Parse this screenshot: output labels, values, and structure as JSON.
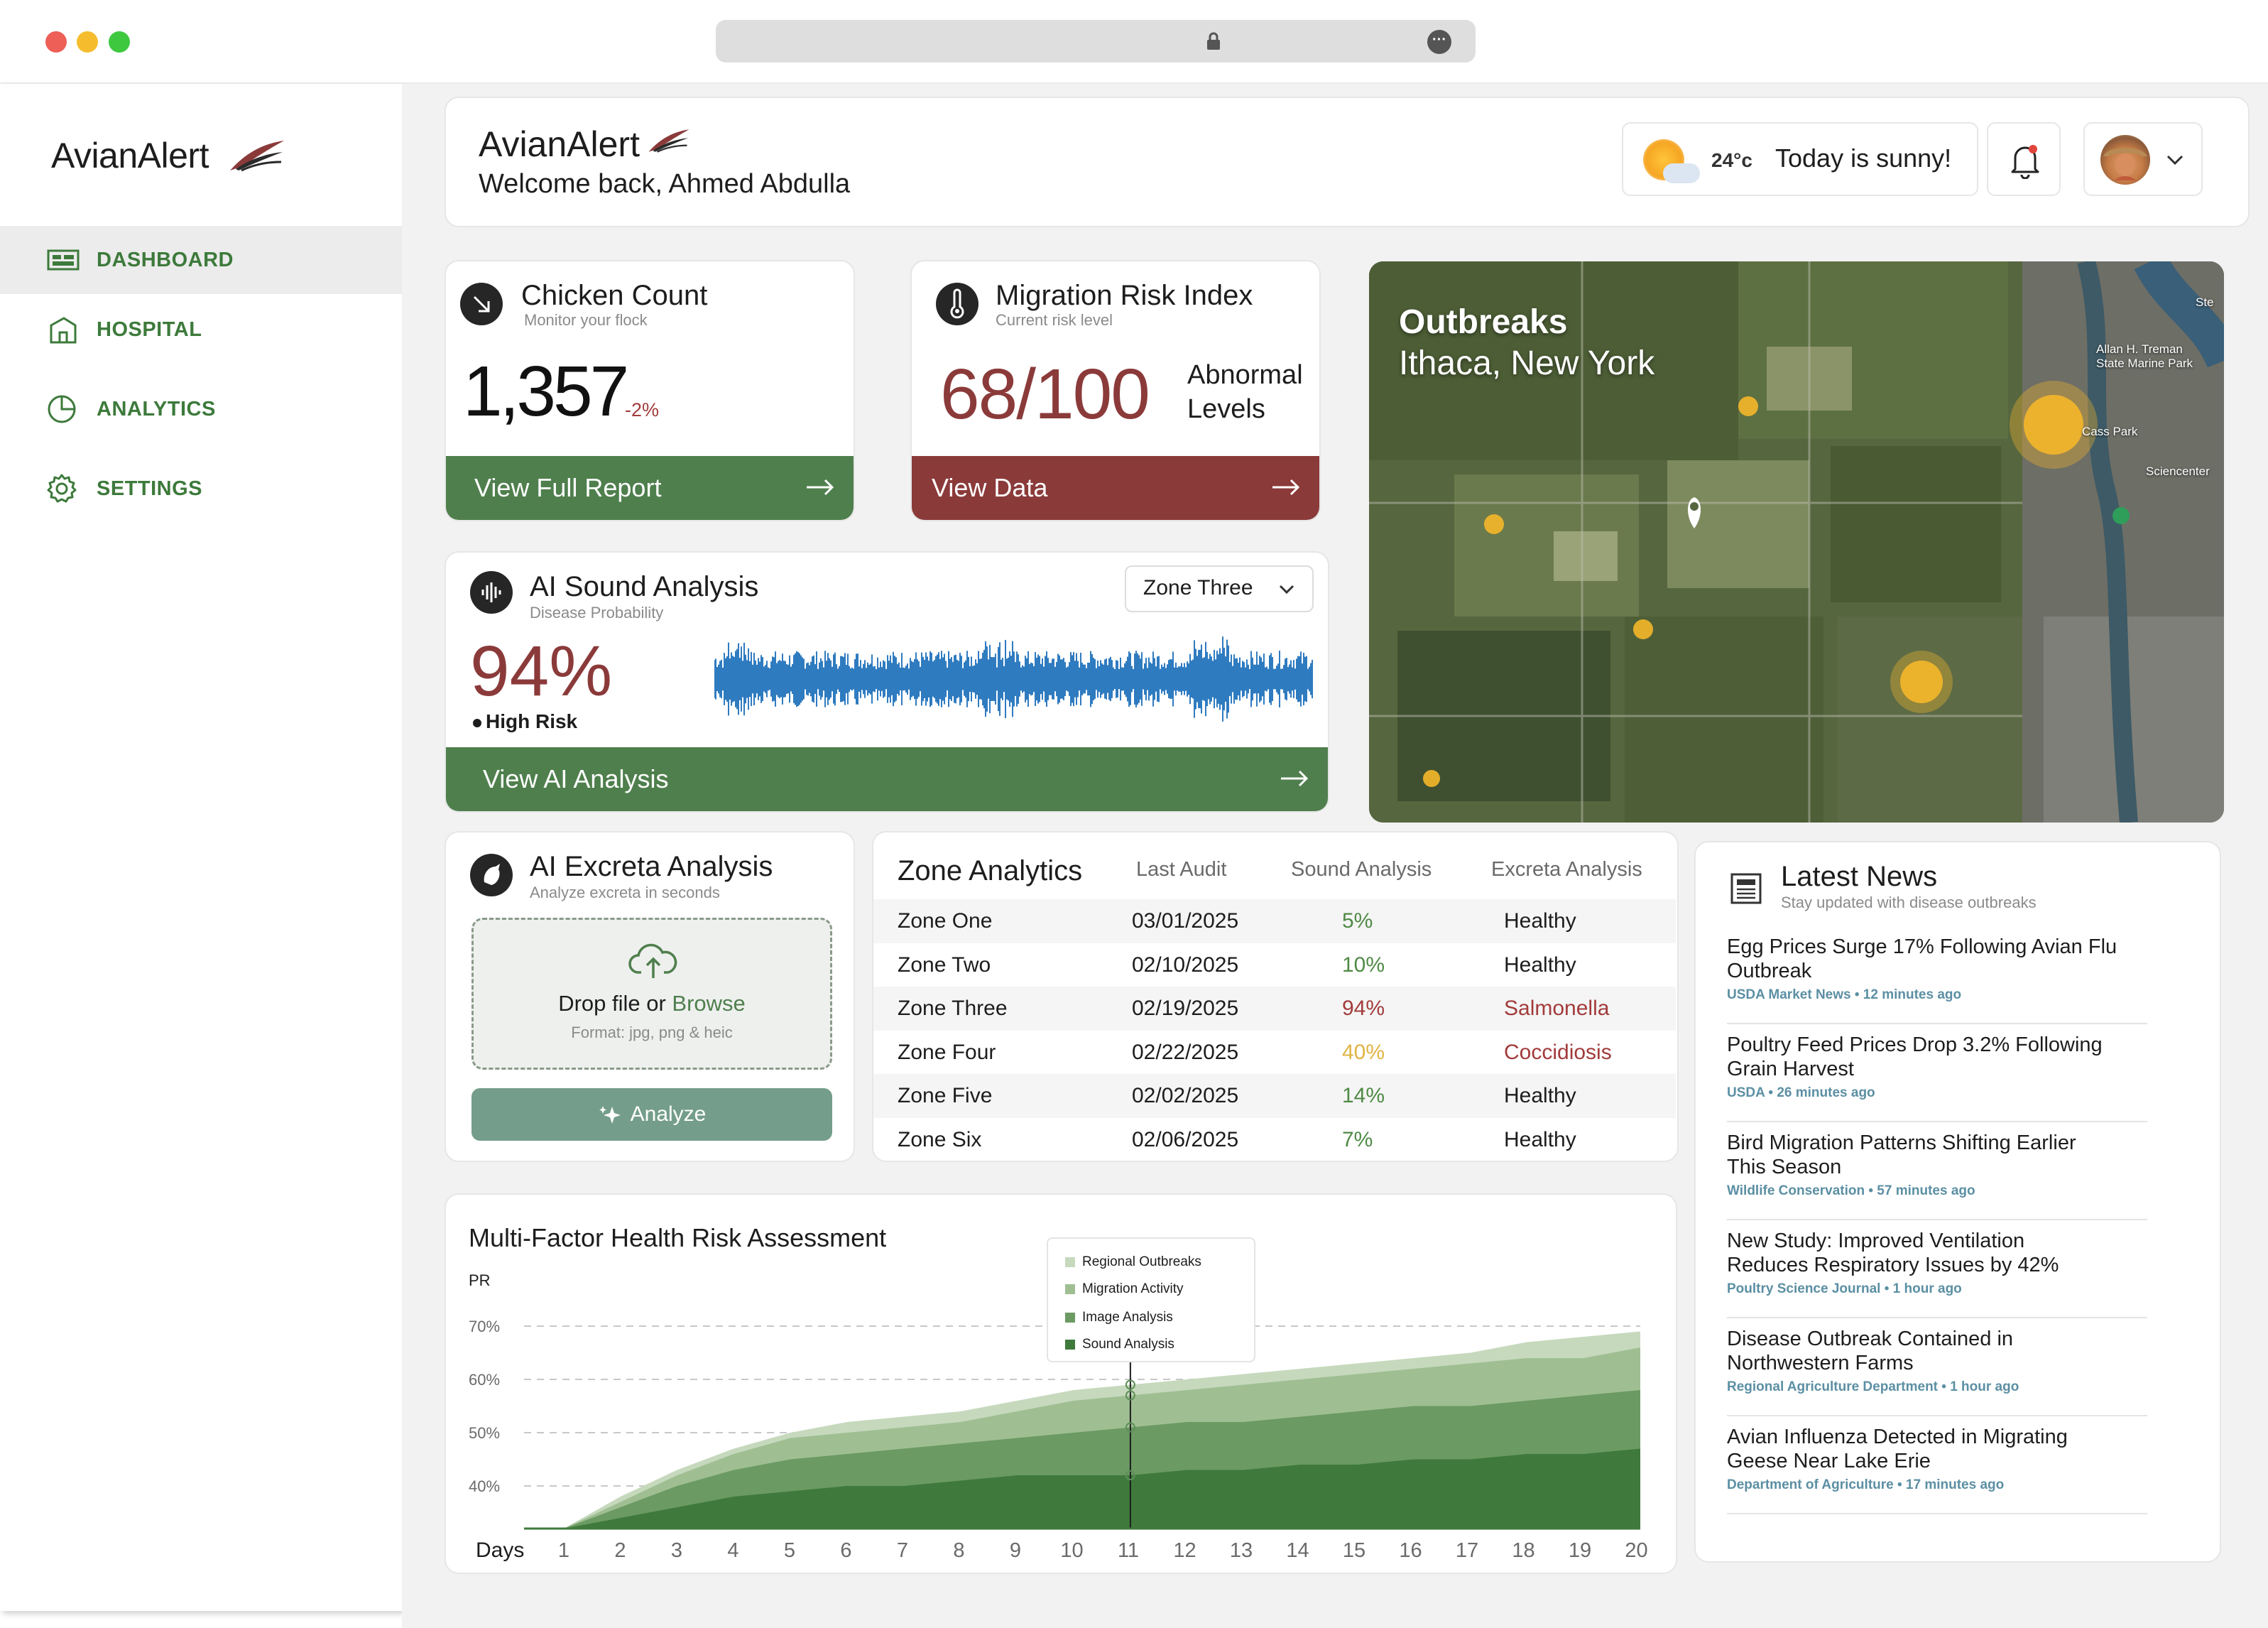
{
  "app": {
    "name": "AvianAlert"
  },
  "sidebar": {
    "items": [
      {
        "label": "DASHBOARD"
      },
      {
        "label": "HOSPITAL"
      },
      {
        "label": "ANALYTICS"
      },
      {
        "label": "SETTINGS"
      }
    ]
  },
  "header": {
    "title": "AvianAlert",
    "welcome_prefix": "Welcome back, ",
    "user_name": "Ahmed Abdulla",
    "weather_temp": "24°c",
    "weather_text": "Today is sunny!"
  },
  "chicken_count": {
    "title": "Chicken Count",
    "subtitle": "Monitor your flock",
    "value": "1,357",
    "delta": "-2%",
    "action": "View Full Report"
  },
  "migration": {
    "title": "Migration Risk Index",
    "subtitle": "Current risk level",
    "value": "68/100",
    "label_line1": "Abnormal",
    "label_line2": "Levels",
    "action": "View Data"
  },
  "sound": {
    "title": "AI Sound Analysis",
    "subtitle": "Disease Probability",
    "value": "94%",
    "risk": "High Risk",
    "zone_select": "Zone Three",
    "action": "View AI Analysis"
  },
  "map": {
    "title": "Outbreaks",
    "location": "Ithaca, New York",
    "labels": [
      "Allan H. Treman",
      "State Marine Park",
      "Cass Park",
      "Sciencenter",
      "Ste"
    ]
  },
  "excreta": {
    "title": "AI Excreta Analysis",
    "subtitle": "Analyze excreta in seconds",
    "drop_text": "Drop file or ",
    "browse": "Browse",
    "format": "Format: jpg, png & heic",
    "analyze": "Analyze"
  },
  "zone_table": {
    "title": "Zone Analytics",
    "columns": [
      "Last Audit",
      "Sound Analysis",
      "Excreta Analysis"
    ],
    "rows": [
      {
        "zone": "Zone One",
        "audit": "03/01/2025",
        "sound": "5%",
        "excreta": "Healthy"
      },
      {
        "zone": "Zone Two",
        "audit": "02/10/2025",
        "sound": "10%",
        "excreta": "Healthy"
      },
      {
        "zone": "Zone Three",
        "audit": "02/19/2025",
        "sound": "94%",
        "excreta": "Salmonella"
      },
      {
        "zone": "Zone Four",
        "audit": "02/22/2025",
        "sound": "40%",
        "excreta": "Coccidiosis"
      },
      {
        "zone": "Zone Five",
        "audit": "02/02/2025",
        "sound": "14%",
        "excreta": "Healthy"
      },
      {
        "zone": "Zone Six",
        "audit": "02/06/2025",
        "sound": "7%",
        "excreta": "Healthy"
      }
    ],
    "colors": {
      "green": "#4f8a45",
      "red": "#a23b3b",
      "amber": "#e0b443"
    }
  },
  "news": {
    "title": "Latest News",
    "subtitle": "Stay updated with disease outbreaks",
    "items": [
      {
        "line1": "Egg Prices Surge 17% Following Avian Flu",
        "line2": "Outbreak",
        "meta": "USDA Market News • 12 minutes ago"
      },
      {
        "line1": "Poultry Feed Prices Drop 3.2% Following",
        "line2": "Grain Harvest",
        "meta": "USDA • 26 minutes ago"
      },
      {
        "line1": "Bird Migration Patterns Shifting Earlier",
        "line2": "This Season",
        "meta": "Wildlife Conservation • 57 minutes ago"
      },
      {
        "line1": "New Study: Improved Ventilation",
        "line2": "Reduces Respiratory Issues by 42%",
        "meta": "Poultry Science Journal • 1 hour ago"
      },
      {
        "line1": "Disease Outbreak Contained in",
        "line2": "Northwestern Farms",
        "meta": "Regional Agriculture Department • 1 hour ago"
      },
      {
        "line1": "Avian Influenza Detected in Migrating",
        "line2": "Geese Near Lake Erie",
        "meta": "Department of Agriculture • 17 minutes ago"
      }
    ]
  },
  "chart_data": {
    "type": "area",
    "title": "Multi-Factor Health Risk Assessment",
    "ylabel": "PR",
    "xlabel": "Days",
    "x": [
      1,
      2,
      3,
      4,
      5,
      6,
      7,
      8,
      9,
      10,
      11,
      12,
      13,
      14,
      15,
      16,
      17,
      18,
      19,
      20
    ],
    "yticks": [
      "70%",
      "60%",
      "50%",
      "40%"
    ],
    "ylim": [
      32,
      72
    ],
    "stacked": true,
    "marker_day": 11,
    "series": [
      {
        "name": "Sound Analysis",
        "color": "#3f7a3c",
        "values": [
          32,
          34,
          36,
          38,
          39,
          40,
          40,
          41,
          42,
          42,
          42,
          43,
          43,
          44,
          44,
          45,
          45,
          46,
          46,
          47
        ]
      },
      {
        "name": "Image Analysis",
        "color": "#6b9a63",
        "values": [
          32,
          36,
          40,
          43,
          45,
          46,
          47,
          48,
          49,
          50,
          51,
          52,
          52,
          53,
          54,
          55,
          55,
          56,
          57,
          58
        ]
      },
      {
        "name": "Migration Activity",
        "color": "#9fbf93",
        "values": [
          32,
          37,
          42,
          46,
          49,
          50,
          51,
          52,
          54,
          56,
          57,
          58,
          59,
          60,
          61,
          62,
          63,
          64,
          64,
          66
        ]
      },
      {
        "name": "Regional Outbreaks",
        "color": "#c6d9bd",
        "values": [
          32,
          38,
          43,
          47,
          50,
          52,
          53,
          54,
          56,
          58,
          59,
          60,
          61,
          62,
          63,
          64,
          65,
          67,
          68,
          69
        ]
      }
    ],
    "legend": [
      "Regional Outbreaks",
      "Migration Activity",
      "Image Analysis",
      "Sound Analysis"
    ],
    "legend_position": "top-center",
    "grid": "dashed horizontal"
  }
}
